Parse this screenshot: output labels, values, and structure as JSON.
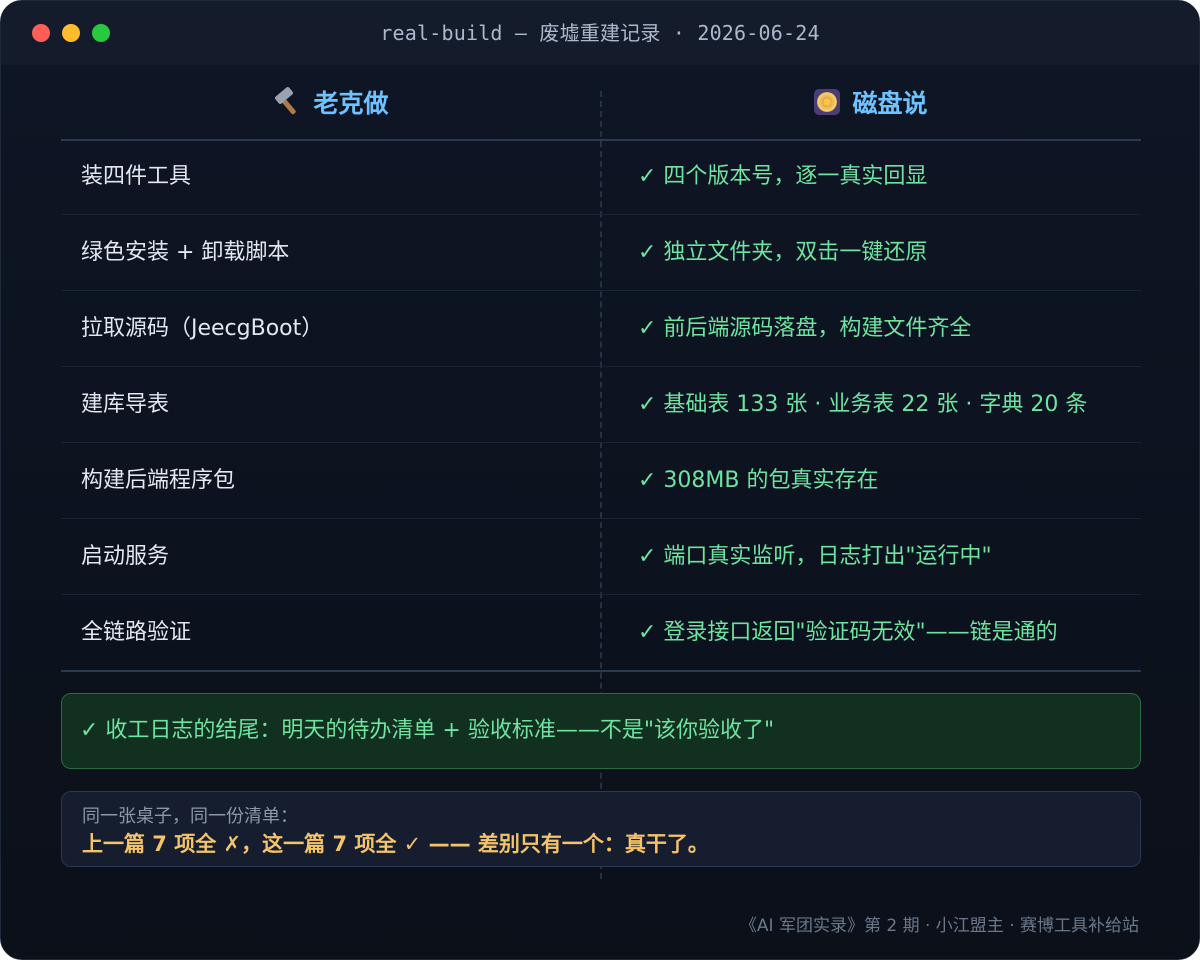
{
  "window": {
    "title": "real-build — 废墟重建记录 · 2026-06-24"
  },
  "table": {
    "left_header": "老克做",
    "right_header": "磁盘说",
    "rows": [
      {
        "action": "装四件工具",
        "result": "✓ 四个版本号，逐一真实回显"
      },
      {
        "action": "绿色安装 + 卸载脚本",
        "result": "✓ 独立文件夹，双击一键还原"
      },
      {
        "action": "拉取源码（JeecgBoot）",
        "result": "✓ 前后端源码落盘，构建文件齐全"
      },
      {
        "action": "建库导表",
        "result": "✓ 基础表 133 张 · 业务表 22 张 · 字典 20 条"
      },
      {
        "action": "构建后端程序包",
        "result": "✓ 308MB 的包真实存在"
      },
      {
        "action": "启动服务",
        "result": "✓ 端口真实监听，日志打出\"运行中\""
      },
      {
        "action": "全链路验证",
        "result": "✓ 登录接口返回\"验证码无效\"——链是通的"
      }
    ]
  },
  "highlight": {
    "text": "✓ 收工日志的结尾：明天的待办清单 + 验收标准——不是\"该你验收了\""
  },
  "note": {
    "line1": "同一张桌子，同一份清单：",
    "line2": "上一篇 7 项全 ✗，这一篇 7 项全 ✓ —— 差别只有一个：真干了。"
  },
  "footer": {
    "text": "《AI 军团实录》第 2 期 · 小江盟主 · 赛博工具补给站"
  },
  "colors": {
    "background": "#0d1321",
    "header_accent": "#6ec2ff",
    "success_green": "#6fe3a0",
    "note_gold": "#f5c36a"
  },
  "icons": {
    "left_header_icon": "hammer-icon",
    "right_header_icon": "disc-icon"
  }
}
